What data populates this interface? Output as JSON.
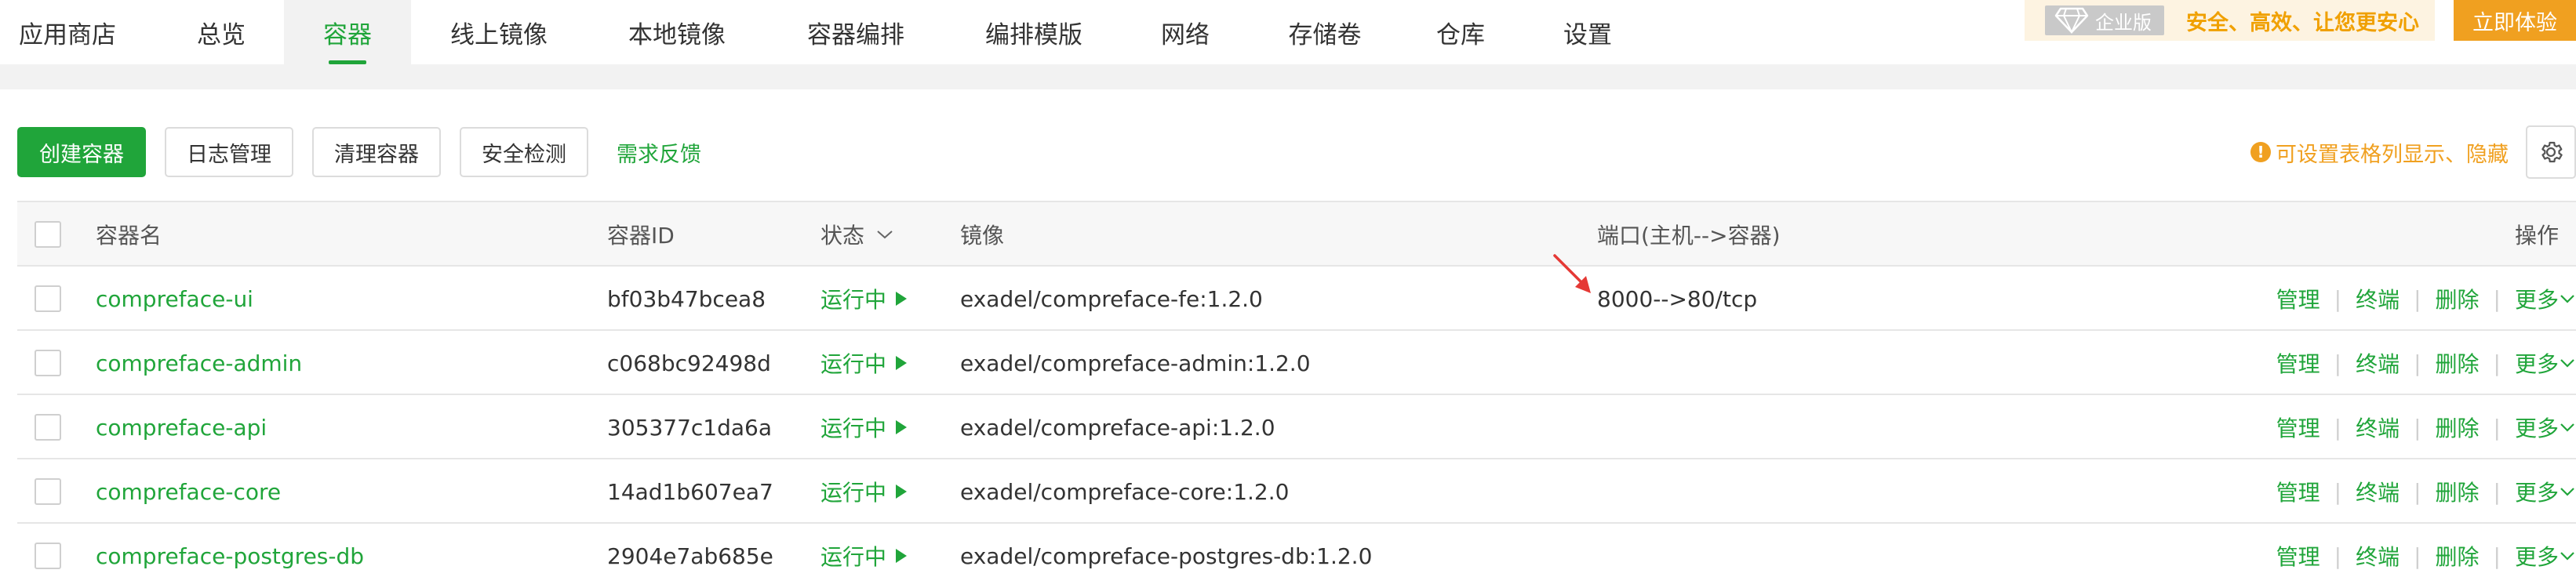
{
  "nav": {
    "tabs": [
      {
        "label": "应用商店",
        "active": false
      },
      {
        "label": "总览",
        "active": false
      },
      {
        "label": "容器",
        "active": true
      },
      {
        "label": "线上镜像",
        "active": false
      },
      {
        "label": "本地镜像",
        "active": false
      },
      {
        "label": "容器编排",
        "active": false
      },
      {
        "label": "编排模版",
        "active": false
      },
      {
        "label": "网络",
        "active": false
      },
      {
        "label": "存储卷",
        "active": false
      },
      {
        "label": "仓库",
        "active": false
      },
      {
        "label": "设置",
        "active": false
      }
    ],
    "promo": {
      "badge_icon": "diamond-icon",
      "badge": "企业版",
      "text": "安全、高效、让您更安心",
      "button": "立即体验"
    }
  },
  "toolbar": {
    "create": "创建容器",
    "logs": "日志管理",
    "clean": "清理容器",
    "security": "安全检测",
    "feedback": "需求反馈",
    "tip_icon": "!",
    "tip": "可设置表格列显示、隐藏",
    "settings_icon": "gear-icon"
  },
  "table": {
    "headers": {
      "name": "容器名",
      "id": "容器ID",
      "status": "状态",
      "image": "镜像",
      "ports": "端口(主机-->容器)",
      "actions": "操作"
    },
    "action_labels": {
      "manage": "管理",
      "terminal": "终端",
      "delete": "删除",
      "more": "更多"
    },
    "rows": [
      {
        "name": "compreface-ui",
        "id": "bf03b47bcea8",
        "status": "运行中",
        "image": "exadel/compreface-fe:1.2.0",
        "ports": "8000-->80/tcp"
      },
      {
        "name": "compreface-admin",
        "id": "c068bc92498d",
        "status": "运行中",
        "image": "exadel/compreface-admin:1.2.0",
        "ports": ""
      },
      {
        "name": "compreface-api",
        "id": "305377c1da6a",
        "status": "运行中",
        "image": "exadel/compreface-api:1.2.0",
        "ports": ""
      },
      {
        "name": "compreface-core",
        "id": "14ad1b607ea7",
        "status": "运行中",
        "image": "exadel/compreface-core:1.2.0",
        "ports": ""
      },
      {
        "name": "compreface-postgres-db",
        "id": "2904e7ab685e",
        "status": "运行中",
        "image": "exadel/compreface-postgres-db:1.2.0",
        "ports": ""
      }
    ]
  },
  "colors": {
    "accent": "#20a53a",
    "warning": "#f0a020",
    "annotation": "#e53935"
  }
}
